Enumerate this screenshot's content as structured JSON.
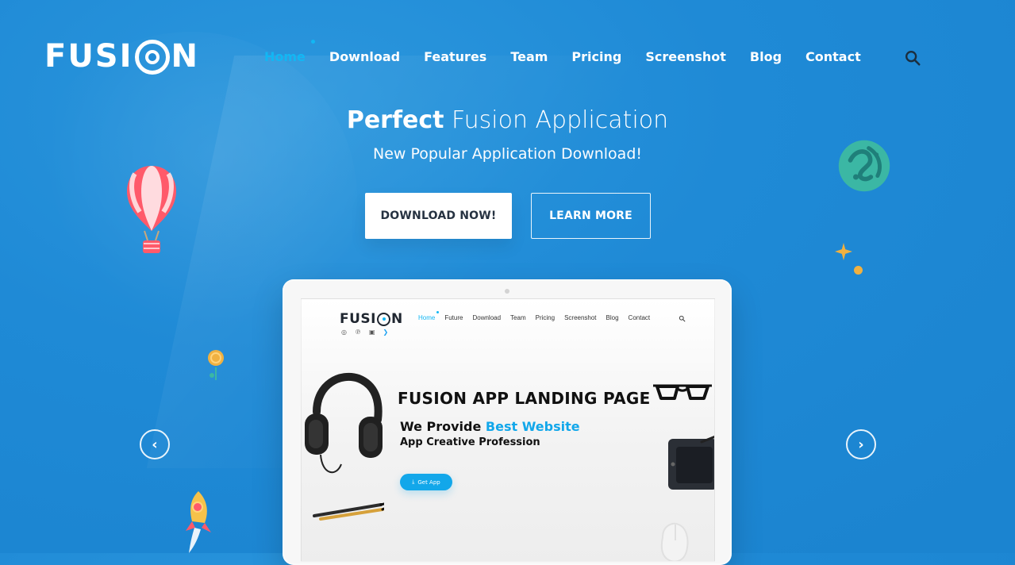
{
  "brand": {
    "logo_left": "FUSI",
    "logo_right": "N"
  },
  "nav": {
    "items": [
      {
        "label": "Home",
        "active": true
      },
      {
        "label": "Download",
        "active": false
      },
      {
        "label": "Features",
        "active": false
      },
      {
        "label": "Team",
        "active": false
      },
      {
        "label": "Pricing",
        "active": false
      },
      {
        "label": "Screenshot",
        "active": false
      },
      {
        "label": "Blog",
        "active": false
      },
      {
        "label": "Contact",
        "active": false
      }
    ]
  },
  "hero": {
    "title_bold": "Perfect",
    "title_rest": "Fusion Application",
    "subtitle": "New Popular Application Download!",
    "primary_cta": "DOWNLOAD NOW!",
    "secondary_cta": "LEARN MORE"
  },
  "mockup": {
    "mini_logo_left": "FUSI",
    "mini_logo_right": "N",
    "mini_nav": [
      "Home",
      "Future",
      "Download",
      "Team",
      "Pricing",
      "Screenshot",
      "Blog",
      "Contact"
    ],
    "headline": "FUSION APP LANDING PAGE",
    "line1_prefix": "We Provide ",
    "line1_accent": "Best Website",
    "line2": "App Creative Profession",
    "button": "Get App"
  },
  "icons": {
    "search": "search-icon",
    "arrow_left": "chevron-left-icon",
    "arrow_right": "chevron-right-icon",
    "download": "download-icon",
    "social": [
      "dribbble-icon",
      "pinterest-icon",
      "youtube-icon",
      "twitter-icon"
    ]
  },
  "colors": {
    "accent_blue": "#12b7f4",
    "bg_blue": "#1f8ad6",
    "button_blue": "#12a7ea"
  }
}
